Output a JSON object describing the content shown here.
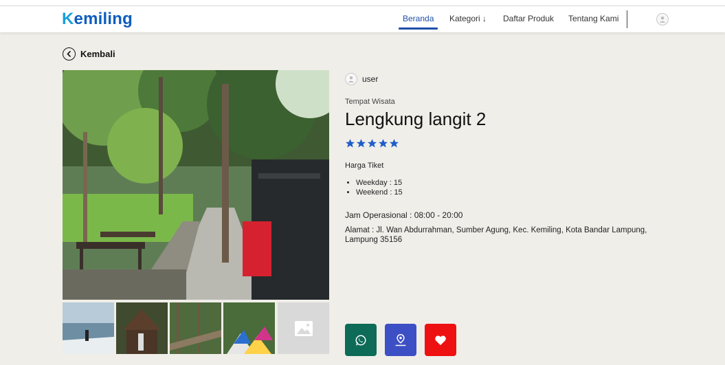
{
  "brand": {
    "name": "emiling",
    "initial": "K"
  },
  "nav": {
    "items": [
      {
        "label": "Beranda",
        "active": true
      },
      {
        "label": "Kategori ↓",
        "active": false
      },
      {
        "label": "Daftar Produk",
        "active": false
      },
      {
        "label": "Tentang Kami",
        "active": false
      }
    ],
    "accent": "#1f4fa8"
  },
  "back": {
    "label": "Kembali"
  },
  "listing": {
    "user": "user",
    "category": "Tempat Wisata",
    "title": "Lengkung langit 2",
    "rating": 5,
    "rating_color": "#1f5ec9",
    "price_label": "Harga Tiket",
    "prices": [
      {
        "text": "Weekday : 15"
      },
      {
        "text": "Weekend : 15"
      }
    ],
    "hours": "Jam Operasional : 08:00 - 20:00",
    "address": "Alamat : Jl. Wan Abdurrahman, Sumber Agung, Kec. Kemiling, Kota Bandar Lampung, Lampung 35156"
  },
  "actions": [
    {
      "name": "whatsapp",
      "icon": "whatsapp-icon",
      "color": "#0d6b57"
    },
    {
      "name": "location",
      "icon": "map-pin-icon",
      "color": "#3d4fc4"
    },
    {
      "name": "favorite",
      "icon": "heart-icon",
      "color": "#ee1111"
    }
  ]
}
